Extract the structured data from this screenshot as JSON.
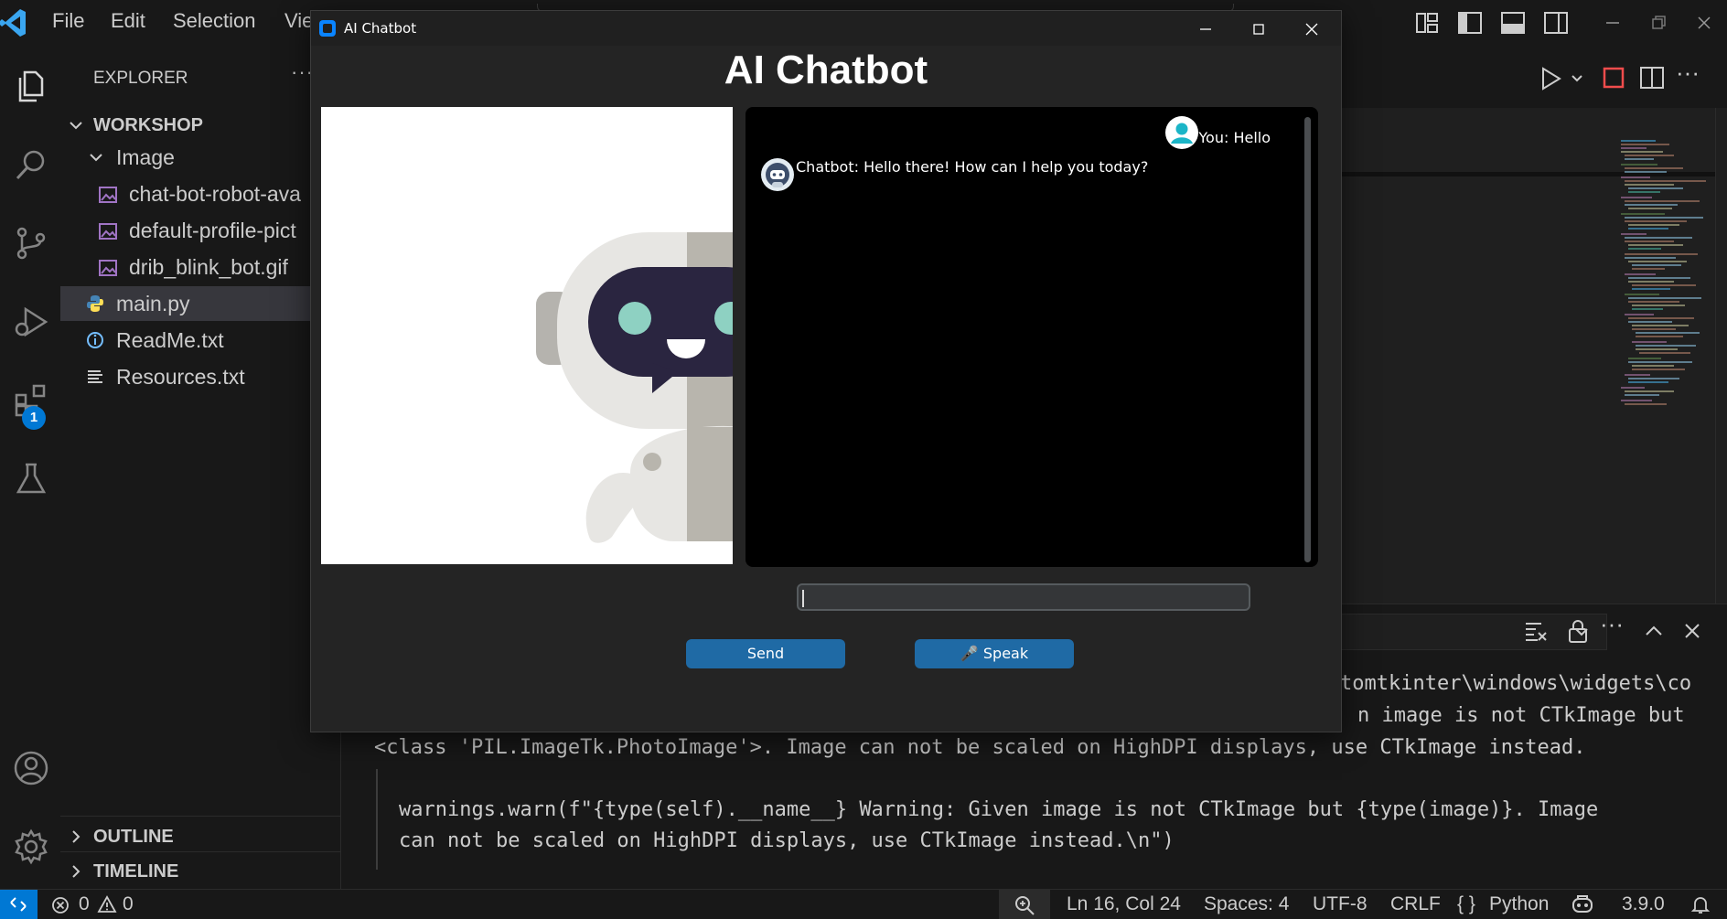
{
  "vscode": {
    "menu": [
      "File",
      "Edit",
      "Selection",
      "Vie"
    ],
    "explorer_title": "EXPLORER",
    "workspace": "WORKSHOP",
    "folder": "Image",
    "files": [
      "chat-bot-robot-ava",
      "default-profile-pict",
      "drib_blink_bot.gif",
      "main.py",
      "ReadMe.txt",
      "Resources.txt"
    ],
    "outline": "OUTLINE",
    "timeline": "TIMELINE",
    "extensions_badge": "1",
    "terminal_lines": [
      "tomtkinter\\windows\\widgets\\co",
      "n image is not CTkImage but",
      "<class 'PIL.ImageTk.PhotoImage'>. Image can not be scaled on HighDPI displays, use CTkImage instead.",
      "warnings.warn(f\"{type(self).__name__} Warning: Given image is not CTkImage but {type(image)}. Image",
      "can not be scaled on HighDPI displays, use CTkImage instead.\\n\")"
    ]
  },
  "status": {
    "errors": "0",
    "warnings": "0",
    "position": "Ln 16, Col 24",
    "spaces": "Spaces: 4",
    "encoding": "UTF-8",
    "eol": "CRLF",
    "language": "Python",
    "version": "3.9.0"
  },
  "chat": {
    "window_title": "AI Chatbot",
    "heading": "AI Chatbot",
    "messages": [
      {
        "sender": "user",
        "text": "You: Hello"
      },
      {
        "sender": "bot",
        "text": "Chatbot: Hello there! How can I help you today?"
      }
    ],
    "input_value": "",
    "send_label": "Send",
    "speak_label": "🎤 Speak"
  },
  "colors": {
    "accent_button": "#1f6aa5",
    "vscode_bg": "#1f1f1f",
    "chat_bg": "#242424",
    "badge": "#0078d4"
  }
}
